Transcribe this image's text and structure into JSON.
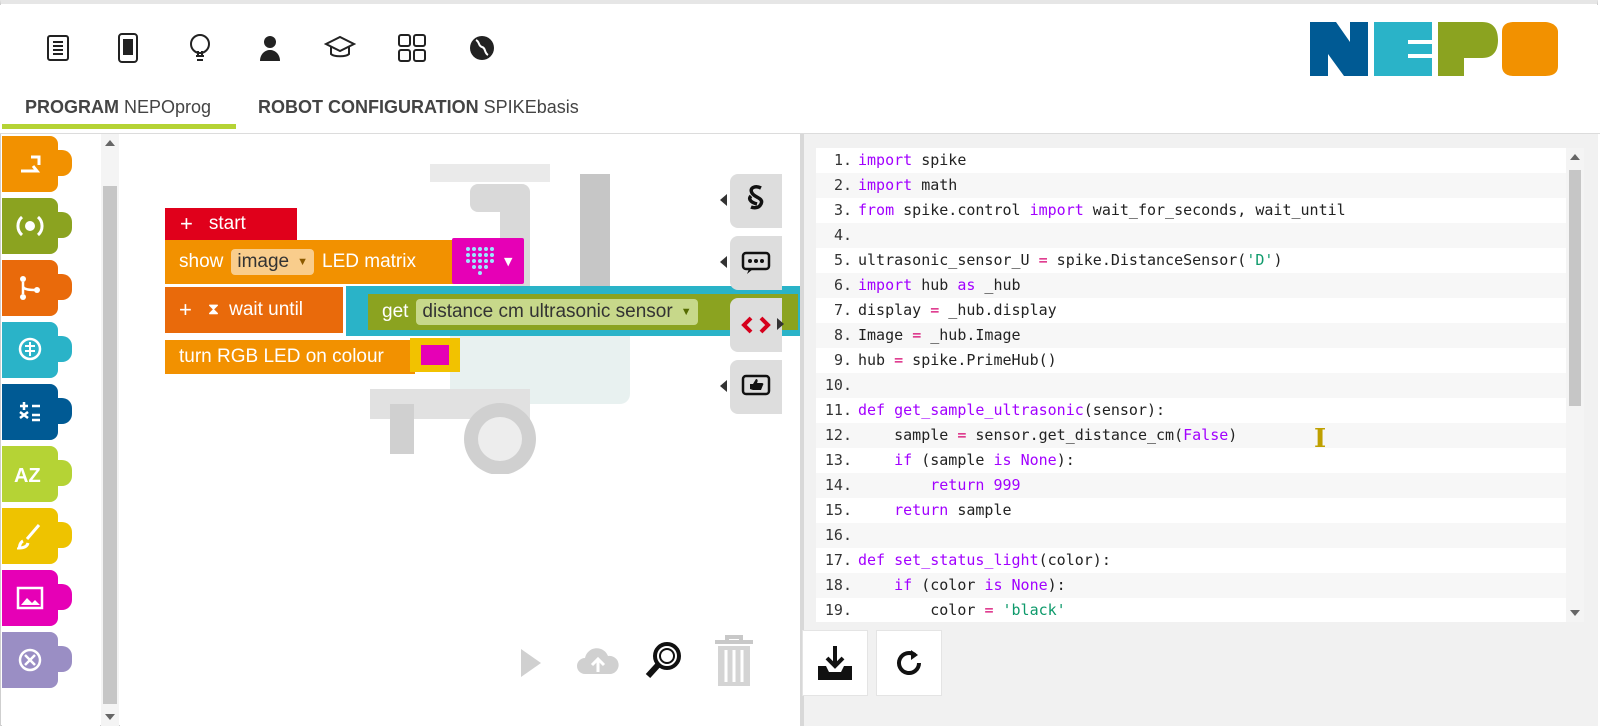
{
  "nav": {
    "icons": [
      "document-icon",
      "tablet-icon",
      "lightbulb-icon",
      "user-icon",
      "graduation-cap-icon",
      "grid-icon",
      "globe-icon"
    ],
    "logo": "NEPO"
  },
  "tabs": {
    "program_label": "PROGRAM",
    "program_name": "NEPOprog",
    "config_label": "ROBOT CONFIGURATION",
    "config_name": "SPIKEbasis"
  },
  "toolbox": {
    "categories": [
      {
        "name": "action",
        "color": "#f29100"
      },
      {
        "name": "sensors",
        "color": "#8ba320"
      },
      {
        "name": "control",
        "color": "#e96a0b"
      },
      {
        "name": "logic",
        "color": "#2ab3c8"
      },
      {
        "name": "math",
        "color": "#005a94"
      },
      {
        "name": "text",
        "color": "#b5d335"
      },
      {
        "name": "colours",
        "color": "#eec300"
      },
      {
        "name": "images",
        "color": "#e600b6"
      },
      {
        "name": "variables",
        "color": "#9a8ec4"
      }
    ]
  },
  "blocks": {
    "start": "start",
    "show_label": "show",
    "show_dropdown": "image",
    "show_suffix": "LED matrix",
    "wait_label": "wait until",
    "get_label": "get",
    "get_dropdown": "distance cm ultrasonic sensor",
    "turn_label": "turn RGB LED on colour"
  },
  "code": {
    "lines": [
      [
        [
          "kw",
          "import"
        ],
        [
          "t",
          " spike"
        ]
      ],
      [
        [
          "kw",
          "import"
        ],
        [
          "t",
          " math"
        ]
      ],
      [
        [
          "kw",
          "from"
        ],
        [
          "t",
          " spike.control "
        ],
        [
          "kw",
          "import"
        ],
        [
          "t",
          " wait_for_seconds, wait_until"
        ]
      ],
      [],
      [
        [
          "t",
          "ultrasonic_sensor_U "
        ],
        [
          "op",
          "="
        ],
        [
          "t",
          " spike.DistanceSensor("
        ],
        [
          "str",
          "'D'"
        ],
        [
          "t",
          ")"
        ]
      ],
      [
        [
          "kw",
          "import"
        ],
        [
          "t",
          " hub "
        ],
        [
          "kw",
          "as"
        ],
        [
          "t",
          " _hub"
        ]
      ],
      [
        [
          "t",
          "display "
        ],
        [
          "op",
          "="
        ],
        [
          "t",
          " _hub.display"
        ]
      ],
      [
        [
          "t",
          "Image "
        ],
        [
          "op",
          "="
        ],
        [
          "t",
          " _hub.Image"
        ]
      ],
      [
        [
          "t",
          "hub "
        ],
        [
          "op",
          "="
        ],
        [
          "t",
          " spike.PrimeHub()"
        ]
      ],
      [],
      [
        [
          "kw",
          "def"
        ],
        [
          "t",
          " "
        ],
        [
          "kw",
          "get_sample_ultrasonic"
        ],
        [
          "t",
          "(sensor):"
        ]
      ],
      [
        [
          "t",
          "    sample "
        ],
        [
          "op",
          "="
        ],
        [
          "t",
          " sensor.get_distance_cm("
        ],
        [
          "kw",
          "False"
        ],
        [
          "t",
          ")"
        ]
      ],
      [
        [
          "t",
          "    "
        ],
        [
          "kw",
          "if"
        ],
        [
          "t",
          " (sample "
        ],
        [
          "kw",
          "is"
        ],
        [
          "t",
          " "
        ],
        [
          "kw",
          "None"
        ],
        [
          "t",
          "):"
        ]
      ],
      [
        [
          "t",
          "        "
        ],
        [
          "kw",
          "return"
        ],
        [
          "t",
          " "
        ],
        [
          "kw",
          "999"
        ]
      ],
      [
        [
          "t",
          "    "
        ],
        [
          "kw",
          "return"
        ],
        [
          "t",
          " sample"
        ]
      ],
      [],
      [
        [
          "kw",
          "def"
        ],
        [
          "t",
          " "
        ],
        [
          "kw",
          "set_status_light"
        ],
        [
          "t",
          "(color):"
        ]
      ],
      [
        [
          "t",
          "    "
        ],
        [
          "kw",
          "if"
        ],
        [
          "t",
          " (color "
        ],
        [
          "kw",
          "is"
        ],
        [
          "t",
          " "
        ],
        [
          "kw",
          "None"
        ],
        [
          "t",
          "):"
        ]
      ],
      [
        [
          "t",
          "        color "
        ],
        [
          "op",
          "="
        ],
        [
          "t",
          " "
        ],
        [
          "str",
          "'black'"
        ]
      ]
    ]
  }
}
